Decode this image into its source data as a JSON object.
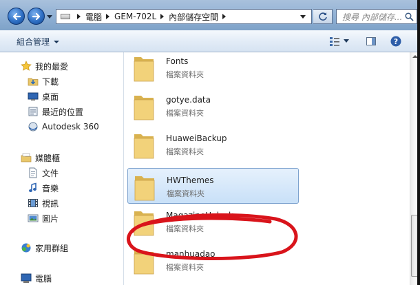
{
  "address_bar": {
    "crumbs": [
      "電腦",
      "GEM-702L",
      "內部儲存空間"
    ]
  },
  "search": {
    "placeholder": "搜尋 內部儲存..."
  },
  "toolbar": {
    "organize_label": "組合管理"
  },
  "sidebar": {
    "favorites_header": "我的最愛",
    "favorites": [
      {
        "label": "下載",
        "icon": "download-folder-icon"
      },
      {
        "label": "桌面",
        "icon": "desktop-icon"
      },
      {
        "label": "最近的位置",
        "icon": "recent-places-icon"
      },
      {
        "label": "Autodesk 360",
        "icon": "cloud-icon"
      }
    ],
    "libraries_header": "媒體櫃",
    "libraries": [
      {
        "label": "文件",
        "icon": "documents-icon"
      },
      {
        "label": "音樂",
        "icon": "music-icon"
      },
      {
        "label": "視訊",
        "icon": "video-icon"
      },
      {
        "label": "圖片",
        "icon": "pictures-icon"
      }
    ],
    "homegroup": "家用群組",
    "computer": "電腦"
  },
  "files": [
    {
      "name": "Fonts",
      "type": "檔案資料夾"
    },
    {
      "name": "gotye.data",
      "type": "檔案資料夾"
    },
    {
      "name": "HuaweiBackup",
      "type": "檔案資料夾"
    },
    {
      "name": "HWThemes",
      "type": "檔案資料夾",
      "selected": true
    },
    {
      "name": "MagazineUnlock",
      "type": "檔案資料夾"
    },
    {
      "name": "manhuadao",
      "type": "檔案資料夾"
    }
  ],
  "colors": {
    "selection_fill": "#c8e0f8",
    "selection_border": "#7da2ce",
    "annotation_red": "#d9141b",
    "folder_yellow": "#f2d27a"
  }
}
